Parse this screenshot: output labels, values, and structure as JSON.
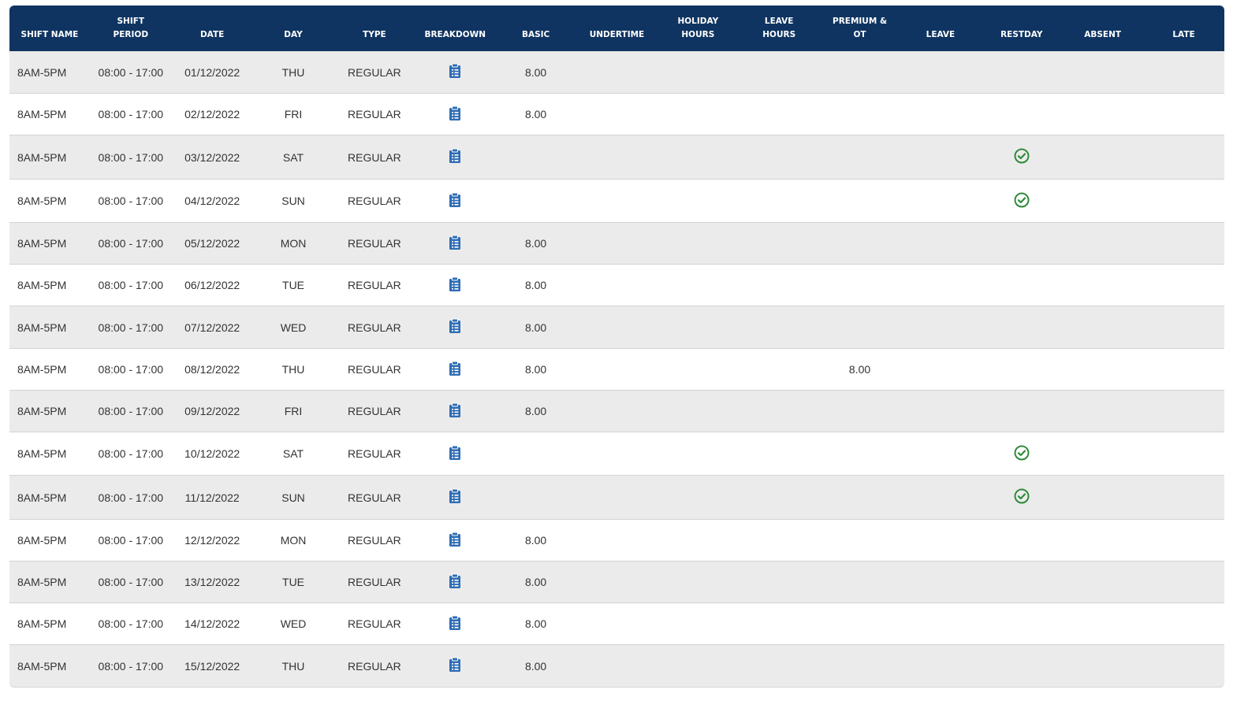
{
  "table": {
    "headers": [
      [
        "SHIFT NAME"
      ],
      [
        "SHIFT",
        "PERIOD"
      ],
      [
        "DATE"
      ],
      [
        "DAY"
      ],
      [
        "TYPE"
      ],
      [
        "BREAKDOWN"
      ],
      [
        "BASIC"
      ],
      [
        "UNDERTIME"
      ],
      [
        "HOLIDAY",
        "HOURS"
      ],
      [
        "LEAVE",
        "HOURS"
      ],
      [
        "PREMIUM &",
        "OT"
      ],
      [
        "LEAVE"
      ],
      [
        "RESTDAY"
      ],
      [
        "ABSENT"
      ],
      [
        "LATE"
      ]
    ],
    "rows": [
      {
        "shift_name": "8AM-5PM",
        "period": "08:00 - 17:00",
        "date": "01/12/2022",
        "day": "THU",
        "type": "REGULAR",
        "basic": "8.00",
        "undertime": "",
        "holiday": "",
        "leave_hours": "",
        "premium": "",
        "leave": "",
        "restday": false,
        "absent": "",
        "late": ""
      },
      {
        "shift_name": "8AM-5PM",
        "period": "08:00 - 17:00",
        "date": "02/12/2022",
        "day": "FRI",
        "type": "REGULAR",
        "basic": "8.00",
        "undertime": "",
        "holiday": "",
        "leave_hours": "",
        "premium": "",
        "leave": "",
        "restday": false,
        "absent": "",
        "late": ""
      },
      {
        "shift_name": "8AM-5PM",
        "period": "08:00 - 17:00",
        "date": "03/12/2022",
        "day": "SAT",
        "type": "REGULAR",
        "basic": "",
        "undertime": "",
        "holiday": "",
        "leave_hours": "",
        "premium": "",
        "leave": "",
        "restday": true,
        "absent": "",
        "late": ""
      },
      {
        "shift_name": "8AM-5PM",
        "period": "08:00 - 17:00",
        "date": "04/12/2022",
        "day": "SUN",
        "type": "REGULAR",
        "basic": "",
        "undertime": "",
        "holiday": "",
        "leave_hours": "",
        "premium": "",
        "leave": "",
        "restday": true,
        "absent": "",
        "late": ""
      },
      {
        "shift_name": "8AM-5PM",
        "period": "08:00 - 17:00",
        "date": "05/12/2022",
        "day": "MON",
        "type": "REGULAR",
        "basic": "8.00",
        "undertime": "",
        "holiday": "",
        "leave_hours": "",
        "premium": "",
        "leave": "",
        "restday": false,
        "absent": "",
        "late": ""
      },
      {
        "shift_name": "8AM-5PM",
        "period": "08:00 - 17:00",
        "date": "06/12/2022",
        "day": "TUE",
        "type": "REGULAR",
        "basic": "8.00",
        "undertime": "",
        "holiday": "",
        "leave_hours": "",
        "premium": "",
        "leave": "",
        "restday": false,
        "absent": "",
        "late": ""
      },
      {
        "shift_name": "8AM-5PM",
        "period": "08:00 - 17:00",
        "date": "07/12/2022",
        "day": "WED",
        "type": "REGULAR",
        "basic": "8.00",
        "undertime": "",
        "holiday": "",
        "leave_hours": "",
        "premium": "",
        "leave": "",
        "restday": false,
        "absent": "",
        "late": ""
      },
      {
        "shift_name": "8AM-5PM",
        "period": "08:00 - 17:00",
        "date": "08/12/2022",
        "day": "THU",
        "type": "REGULAR",
        "basic": "8.00",
        "undertime": "",
        "holiday": "",
        "leave_hours": "",
        "premium": "8.00",
        "leave": "",
        "restday": false,
        "absent": "",
        "late": ""
      },
      {
        "shift_name": "8AM-5PM",
        "period": "08:00 - 17:00",
        "date": "09/12/2022",
        "day": "FRI",
        "type": "REGULAR",
        "basic": "8.00",
        "undertime": "",
        "holiday": "",
        "leave_hours": "",
        "premium": "",
        "leave": "",
        "restday": false,
        "absent": "",
        "late": ""
      },
      {
        "shift_name": "8AM-5PM",
        "period": "08:00 - 17:00",
        "date": "10/12/2022",
        "day": "SAT",
        "type": "REGULAR",
        "basic": "",
        "undertime": "",
        "holiday": "",
        "leave_hours": "",
        "premium": "",
        "leave": "",
        "restday": true,
        "absent": "",
        "late": ""
      },
      {
        "shift_name": "8AM-5PM",
        "period": "08:00 - 17:00",
        "date": "11/12/2022",
        "day": "SUN",
        "type": "REGULAR",
        "basic": "",
        "undertime": "",
        "holiday": "",
        "leave_hours": "",
        "premium": "",
        "leave": "",
        "restday": true,
        "absent": "",
        "late": ""
      },
      {
        "shift_name": "8AM-5PM",
        "period": "08:00 - 17:00",
        "date": "12/12/2022",
        "day": "MON",
        "type": "REGULAR",
        "basic": "8.00",
        "undertime": "",
        "holiday": "",
        "leave_hours": "",
        "premium": "",
        "leave": "",
        "restday": false,
        "absent": "",
        "late": ""
      },
      {
        "shift_name": "8AM-5PM",
        "period": "08:00 - 17:00",
        "date": "13/12/2022",
        "day": "TUE",
        "type": "REGULAR",
        "basic": "8.00",
        "undertime": "",
        "holiday": "",
        "leave_hours": "",
        "premium": "",
        "leave": "",
        "restday": false,
        "absent": "",
        "late": ""
      },
      {
        "shift_name": "8AM-5PM",
        "period": "08:00 - 17:00",
        "date": "14/12/2022",
        "day": "WED",
        "type": "REGULAR",
        "basic": "8.00",
        "undertime": "",
        "holiday": "",
        "leave_hours": "",
        "premium": "",
        "leave": "",
        "restday": false,
        "absent": "",
        "late": ""
      },
      {
        "shift_name": "8AM-5PM",
        "period": "08:00 - 17:00",
        "date": "15/12/2022",
        "day": "THU",
        "type": "REGULAR",
        "basic": "8.00",
        "undertime": "",
        "holiday": "",
        "leave_hours": "",
        "premium": "",
        "leave": "",
        "restday": false,
        "absent": "",
        "late": ""
      }
    ]
  },
  "icons": {
    "breakdown": "clipboard-list-icon",
    "restday": "check-circle-icon"
  },
  "colors": {
    "header_bg": "#0f3461",
    "breakdown_icon": "#2f6db5",
    "check_icon": "#2e8b3a",
    "row_alt": "#ebebeb"
  }
}
